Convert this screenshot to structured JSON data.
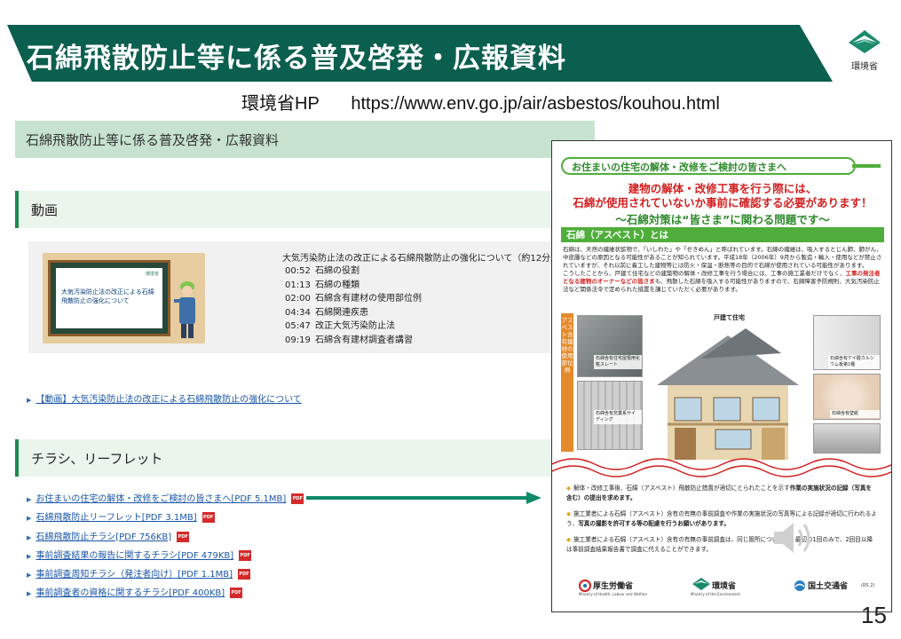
{
  "slide": {
    "title": "石綿飛散防止等に係る普及啓発・広報資料",
    "logo_text": "環境省",
    "hp_label": "環境省HP",
    "hp_url": "https://www.env.go.jp/air/asbestos/kouhou.html",
    "page_number": "15"
  },
  "web": {
    "header": "石綿飛散防止等に係る普及啓発・広報資料",
    "video_section": "動画",
    "video_title": "大気汚染防止法の改正による石綿飛散防止の強化について（約12分）",
    "thumbnail_text": "大気汚染防止法の改正による石綿飛散防止の強化について",
    "thumbnail_logo": "環境省",
    "chapters": [
      {
        "time": "00:52",
        "label": "石綿の役割"
      },
      {
        "time": "01:13",
        "label": "石綿の種類"
      },
      {
        "time": "02:00",
        "label": "石綿含有建材の使用部位例"
      },
      {
        "time": "04:34",
        "label": "石綿関連疾患"
      },
      {
        "time": "05:47",
        "label": "改正大気汚染防止法"
      },
      {
        "time": "09:19",
        "label": "石綿含有建材調査者講習"
      }
    ],
    "video_link": "【動画】大気汚染防止法の改正による石綿飛散防止の強化について",
    "flyer_section": "チラシ、リーフレット",
    "flyers": [
      "お住まいの住宅の解体・改修をご検討の皆さまへ[PDF 5.1MB]",
      "石綿飛散防止リーフレット[PDF 3.1MB]",
      "石綿飛散防止チラシ[PDF 756KB]",
      "事前調査結果の報告に関するチラシ[PDF 479KB]",
      "事前調査周知チラシ（発注者向け）[PDF 1.1MB]",
      "事前調査者の資格に関するチラシ[PDF 400KB]"
    ],
    "pdf_icon": "PDF"
  },
  "flyer": {
    "ribbon": "お住まいの住宅の解体・改修をご検討の皆さまへ",
    "red_line1": "建物の解体・改修工事を行う際には、",
    "red_line2": "石綿が使用されていないか事前に確認する必要があります！",
    "green_sub": "〜石綿対策は“皆さま”に関わる問題です〜",
    "section": "石綿（アスベスト）とは",
    "body1": "石綿は、天然の繊維状鉱物で、「いしわた」や「せきめん」と呼ばれています。石綿の繊維は、吸入するとじん肺、肺がん、中皮腫などの原因となる可能性があることが知られています。平成18年（2006年）9月から製造・輸入・使用などが禁止されていますが、それ以前に着工した建物等には防火・保温・断熱等の目的で石綿が使用されている可能性があります。",
    "body2a": "こうしたことから、戸建て住宅などの建築物の解体・改修工事を行う場合には、工事の施工業者だけでなく、",
    "body2_hl": "工事の発注者となる建物のオーナーなどの皆さま",
    "body2b": "も、飛散した石綿を吸入する可能性がありますので、石綿障害予防規則、大気汚染防止法など関係法令で定められた措置を講じていただく必要があります。",
    "side_label": "アスベスト含有建材の使用部位例",
    "house_title": "戸建て住宅",
    "photos": [
      {
        "caption": "石綿含有住宅屋根用化粧スレート"
      },
      {
        "caption": "石綿含有窯業系サイディング"
      },
      {
        "caption": "石綿含有ケイ酸カルシウム板第1種"
      },
      {
        "caption": "石綿含有壁紙"
      }
    ],
    "notes": [
      {
        "text": "解体・改修工事後、石綿（アスベスト）飛散防止措置が適切にとられたことを示す",
        "bold": "作業の実施状況の記録（写真を含む）の提出を求めます。"
      },
      {
        "text": "施工業者による石綿（アスベスト）含有の有無の事前調査や作業の実施状況の写真等による記録が適切に行われるよう、",
        "bold": "写真の撮影を許可する等の配慮を行うお願いがあります。"
      },
      {
        "text": "施工業者による石綿（アスベスト）含有の有無の事前調査は、同じ箇所については、最初の1回のみで、2回目以降は事前調査結果報告書で調査に代えることができます。",
        "bold": ""
      }
    ],
    "ministries": [
      {
        "name": "厚生労働省",
        "sub": "Ministry of Health, Labour and Welfare"
      },
      {
        "name": "環境省",
        "sub": "Ministry of the Environment"
      },
      {
        "name": "国土交通省",
        "sub": ""
      }
    ],
    "version": "(R5.2)"
  },
  "colors": {
    "banner": "#0b5f4e",
    "flyer_green": "#4fae3b",
    "flyer_red": "#d21f1f",
    "link": "#1a56a8"
  }
}
